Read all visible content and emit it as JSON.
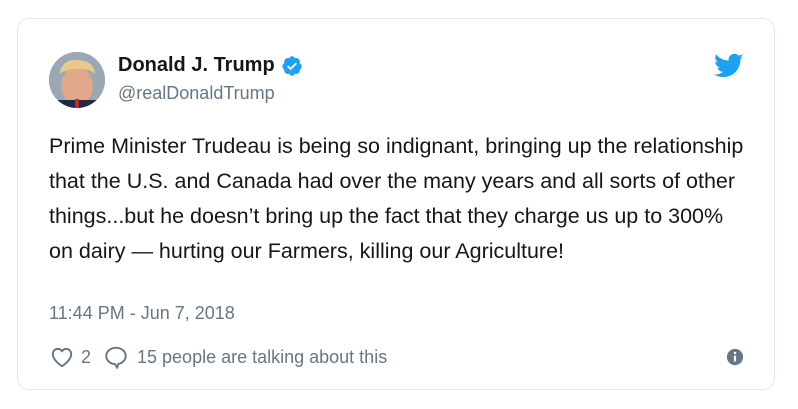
{
  "author": {
    "name": "Donald J. Trump",
    "handle": "@realDonaldTrump",
    "avatar_icon": "profile-photo",
    "verified_icon": "verified-badge-icon"
  },
  "tweet": {
    "text": "Prime Minister Trudeau is being so indignant, bringing up the relationship that the U.S. and Canada had over the many years and all sorts of other things...but he doesn’t bring up the fact that they charge us up to 300% on dairy — hurting our Farmers, killing our Agriculture!",
    "timestamp": "11:44 PM - Jun 7, 2018"
  },
  "actions": {
    "like_count": "2",
    "talking_text": "15 people are talking about this"
  },
  "icons": {
    "logo": "twitter-bird-icon",
    "like": "heart-icon",
    "reply": "speech-bubble-icon",
    "info": "info-icon"
  },
  "colors": {
    "accent": "#1da1f2",
    "text": "#14171a",
    "secondary": "#657786",
    "border": "#e1e8ed"
  }
}
